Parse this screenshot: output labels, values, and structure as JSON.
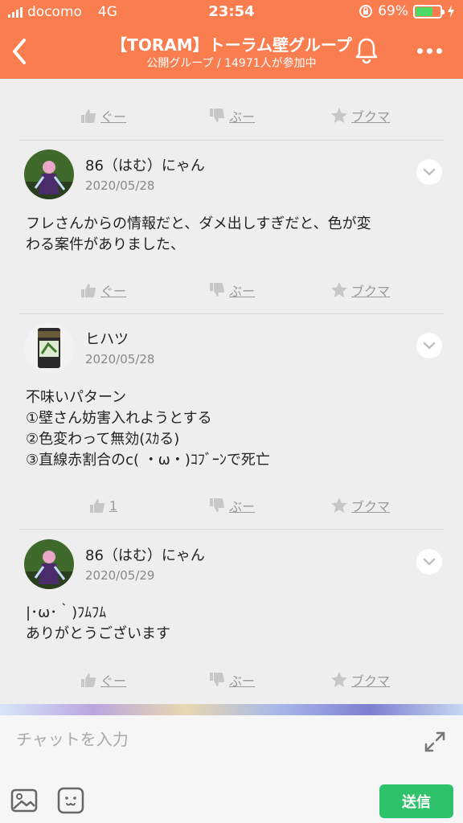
{
  "status_bar": {
    "carrier": "docomo",
    "network": "4G",
    "time": "23:54",
    "battery_percent": "69%",
    "battery_level": 0.69
  },
  "header": {
    "title": "【TORAM】トーラム壁グループ",
    "subtitle": "公開グループ / 14971人が参加中",
    "color": "#f97d4f"
  },
  "actions_labels": {
    "good": "ぐー",
    "boo": "ぶー",
    "bookmark": "ブクマ"
  },
  "posts": [
    {
      "name": "86（はむ）にゃん",
      "date": "2020/05/28",
      "lines": [
        "フレさんからの情報だと、ダメ出しすぎだと、色が変",
        "わる案件がありました、"
      ],
      "good": "ぐー"
    },
    {
      "name": "ヒハツ",
      "date": "2020/05/28",
      "lines": [
        "不味いパターン",
        "①壁さん妨害入れようとする",
        "②色変わって無効(ｽｶる)",
        "③直線赤割合のc( ・ω・)ｺﾌﾞｰﾝで死亡"
      ],
      "good": "1"
    },
    {
      "name": "86（はむ）にゃん",
      "date": "2020/05/29",
      "lines": [
        "|･ω･｀)ﾌﾑﾌﾑ",
        "ありがとうございます"
      ],
      "good": "ぐー"
    }
  ],
  "composer": {
    "placeholder": "チャットを入力",
    "send_label": "送信"
  },
  "icons": [
    "back-icon",
    "bell-icon",
    "more-icon",
    "thumbs-up-icon",
    "thumbs-down-icon",
    "star-icon",
    "chevron-down-icon",
    "expand-icon",
    "image-icon",
    "emoji-icon"
  ]
}
